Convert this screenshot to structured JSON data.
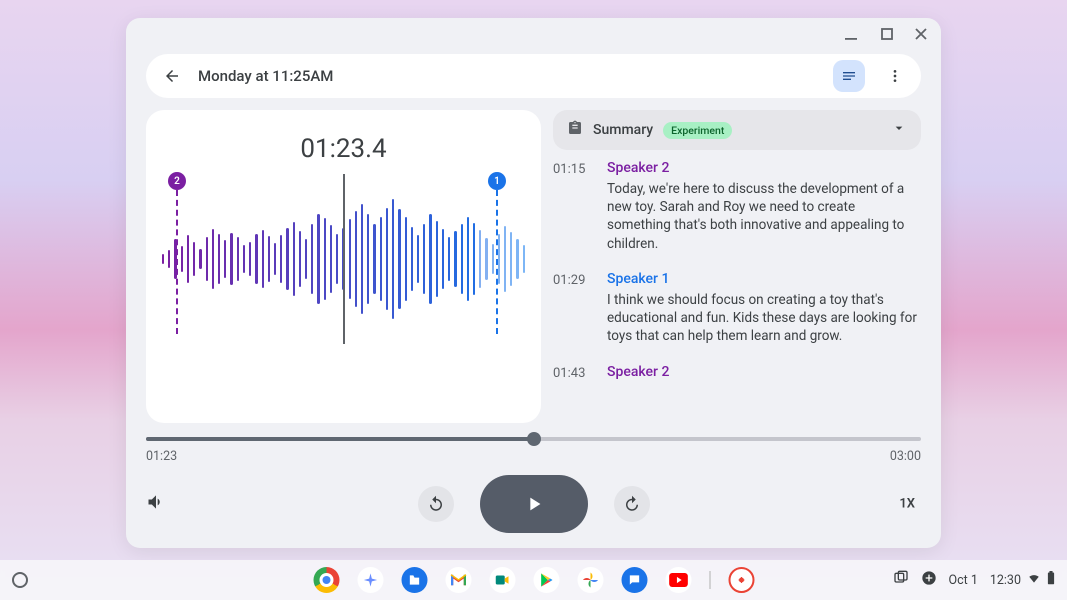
{
  "window": {
    "title": "Monday at 11:25AM"
  },
  "timecode": "01:23.4",
  "markers": {
    "sp1": "1",
    "sp2": "2"
  },
  "summary": {
    "label": "Summary",
    "badge": "Experiment"
  },
  "transcript": [
    {
      "time": "01:15",
      "speaker": "Speaker 2",
      "speaker_class": "sp-a",
      "text": "Today, we're here to discuss the development of a new toy. Sarah and Roy we need to create something that's both innovative and appealing to children."
    },
    {
      "time": "01:29",
      "speaker": "Speaker 1",
      "speaker_class": "sp-b",
      "text": "I think we should focus on creating a toy that's educational and fun. Kids these days are looking for toys that can help them learn and grow."
    },
    {
      "time": "01:43",
      "speaker": "Speaker 2",
      "speaker_class": "sp-a",
      "text": ""
    }
  ],
  "progress": {
    "current": "01:23",
    "total": "03:00",
    "percent": 50
  },
  "speed": "1X",
  "shelf": {
    "date": "Oct 1",
    "time": "12:30"
  }
}
